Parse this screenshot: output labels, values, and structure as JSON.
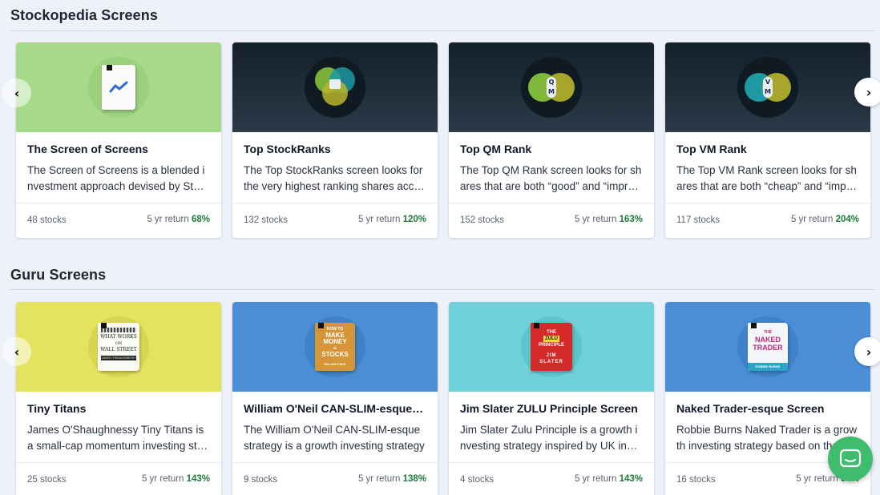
{
  "sections": [
    {
      "title": "Stockopedia Screens",
      "cards": [
        {
          "title": "The Screen of Screens",
          "description": "The Screen of Screens is a blended investment approach devised by Stockopedia",
          "stocks": "48 stocks",
          "return_label": "5 yr return",
          "return_value": "68%",
          "hero_color": "#a7d98b",
          "icon": "chart-book-icon"
        },
        {
          "title": "Top StockRanks",
          "description": "The Top StockRanks screen looks for the very highest ranking shares according",
          "stocks": "132 stocks",
          "return_label": "5 yr return",
          "return_value": "120%",
          "hero_color": "#1e2b36",
          "icon": "venn-stockrank-icon"
        },
        {
          "title": "Top QM Rank",
          "description": "The Top QM Rank screen looks for shares that are both “good” and “improving”",
          "stocks": "152 stocks",
          "return_label": "5 yr return",
          "return_value": "163%",
          "hero_color": "#1e2b36",
          "icon": "venn-qm-icon"
        },
        {
          "title": "Top VM Rank",
          "description": "The Top VM Rank screen looks for shares that are both “cheap” and “improving”",
          "stocks": "117 stocks",
          "return_label": "5 yr return",
          "return_value": "204%",
          "hero_color": "#1e2b36",
          "icon": "venn-vm-icon"
        }
      ]
    },
    {
      "title": "Guru Screens",
      "cards": [
        {
          "title": "Tiny Titans",
          "description": "James O'Shaughnessy Tiny Titans is a small-cap momentum investing strategy",
          "stocks": "25 stocks",
          "return_label": "5 yr return",
          "return_value": "143%",
          "hero_color": "#e3e35f",
          "icon": "book-what-works-icon"
        },
        {
          "title": "William O'Neil CAN-SLIM-esque screen",
          "description": "The William O'Neil CAN-SLIM-esque strategy is a growth investing strategy",
          "stocks": "9 stocks",
          "return_label": "5 yr return",
          "return_value": "138%",
          "hero_color": "#4a8fd6",
          "icon": "book-make-money-icon"
        },
        {
          "title": "Jim Slater ZULU Principle Screen",
          "description": "Jim Slater Zulu Principle is a growth investing strategy inspired by UK investor",
          "stocks": "4 stocks",
          "return_label": "5 yr return",
          "return_value": "143%",
          "hero_color": "#6fd0d8",
          "icon": "book-zulu-principle-icon"
        },
        {
          "title": "Naked Trader-esque Screen",
          "description": "Robbie Burns Naked Trader is a growth investing strategy based on the",
          "stocks": "16 stocks",
          "return_label": "5 yr return",
          "return_value": "94%",
          "hero_color": "#4a8fd6",
          "icon": "book-naked-trader-icon"
        }
      ]
    }
  ],
  "books": {
    "what_works": {
      "line1": "WHAT WORKS",
      "line2": "ON",
      "line3": "WALL STREET",
      "author": "JAMES O'SHAUGHNESSY"
    },
    "make_money": {
      "line1": "HOW TO",
      "line2": "MAKE",
      "line3": "MONEY",
      "line4": "IN",
      "line5": "STOCKS",
      "author": "WILLIAM O'NEIL"
    },
    "zulu": {
      "line1": "THE",
      "line2": "ZULU",
      "line3": "PRINCIPLE",
      "author1": "JIM",
      "author2": "SLATER"
    },
    "naked": {
      "line1": "THE",
      "line2": "NAKED",
      "line3": "TRADER",
      "author": "ROBBIE BURNS"
    }
  },
  "venn_labels": {
    "qm_top": "Q",
    "qm_bottom": "M",
    "vm_top": "V",
    "vm_bottom": "M"
  },
  "nav": {
    "prev_glyph": "‹",
    "next_glyph": "›"
  },
  "colors": {
    "return_green": "#1f7a3a",
    "chat_green": "#3fbc6e",
    "page_bg": "#eef1fa"
  }
}
